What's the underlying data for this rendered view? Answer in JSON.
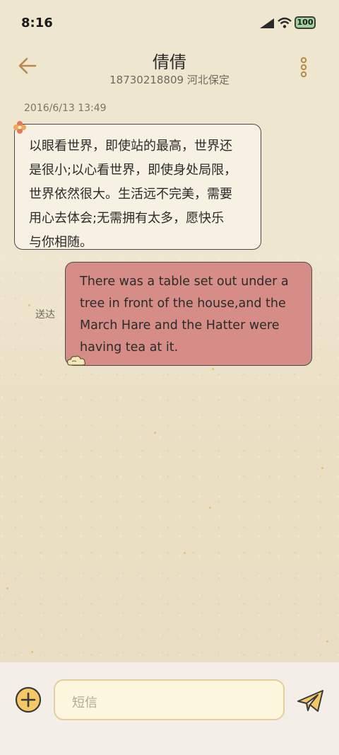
{
  "status_bar": {
    "time": "8:16",
    "battery": "100"
  },
  "header": {
    "name": "倩倩",
    "subtitle": "18730218809 河北保定"
  },
  "messages": [
    {
      "timestamp": "2016/6/13 13:49",
      "direction": "incoming",
      "lines": [
        "以眼看世界，即使站的最高，世界还",
        "是很小;以心看世界，即使身处局限，",
        "世界依然很大。生活远不完美，需要",
        "用心去体会;无需拥有太多，愿快乐",
        "与你相随。"
      ]
    },
    {
      "direction": "outgoing",
      "status": "送达",
      "lines": [
        "There was a table set out under a",
        "tree in front of the house,and the",
        "March Hare and the Hatter were",
        "having tea at it."
      ]
    }
  ],
  "composer": {
    "placeholder": "短信"
  },
  "icons": [
    "back-arrow-icon",
    "more-vertical-icon",
    "flower-icon",
    "cloud-icon",
    "plus-icon",
    "send-icon",
    "signal-icon",
    "wifi-icon"
  ],
  "colors": {
    "incoming_bubble": "#f6f1e3",
    "outgoing_bubble": "#d68c87",
    "accent": "#b88a4a"
  }
}
